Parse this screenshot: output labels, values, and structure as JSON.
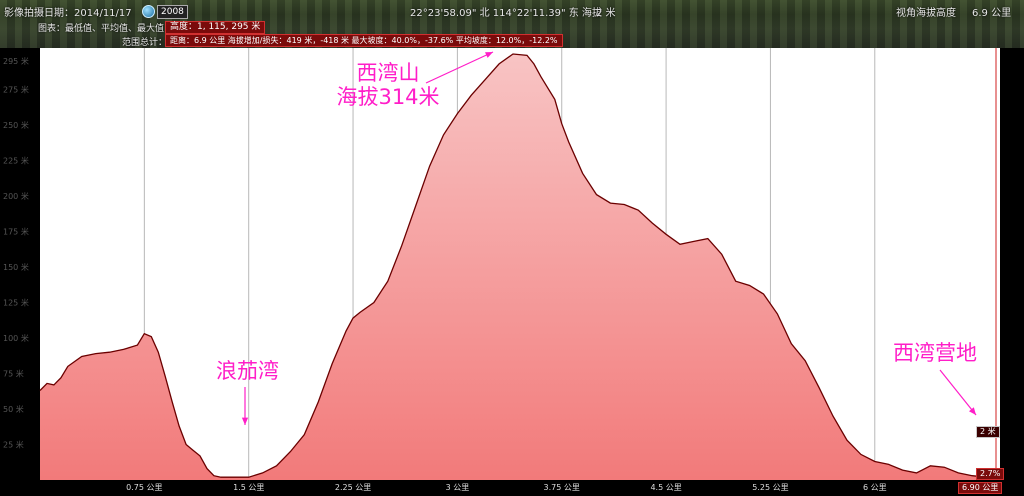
{
  "header": {
    "imagery_date": "影像拍摄日期：2014/11/17",
    "year_badge": "2008",
    "coords": "22°23'58.09\" 北 114°22'11.39\" 东 海拔",
    "altitude": "2 米",
    "eye_alt": "视角海拔高度",
    "eye_alt_value": "6.9 公里",
    "row2_label": "图表：最低值、平均值、最大值",
    "height_readout": "高度：1, 115, 295 米",
    "row3_label": "范围总计：",
    "summary": "距离：6.9 公里 海拔增加/损失：419 米，-418 米 最大坡度：40.0%，-37.6% 平均坡度：12.0%，-12.2%"
  },
  "end_badges": {
    "elev": "2 米",
    "slope": "2.7%",
    "distance": "6.90 公里"
  },
  "icons": {
    "globe": "globe-icon",
    "arrow": "arrow-pointer"
  },
  "colors": {
    "fill_top": "#f8c4c4",
    "fill_bottom": "#f27a7a",
    "line": "#6b0000",
    "annotation": "#ff1ec8"
  },
  "chart_data": {
    "type": "area",
    "xlabel": "",
    "ylabel": "",
    "xlim": [
      0,
      6.9
    ],
    "ylim": [
      0,
      300
    ],
    "y_ticks": [
      25,
      50,
      75,
      100,
      125,
      150,
      175,
      200,
      225,
      250,
      275,
      295
    ],
    "y_tick_labels": [
      "25 米",
      "50 米",
      "75 米",
      "100 米",
      "125 米",
      "150 米",
      "175 米",
      "200 米",
      "225 米",
      "250 米",
      "275 米",
      "295 米"
    ],
    "x_ticks": [
      0.75,
      1.5,
      2.25,
      3.0,
      3.75,
      4.5,
      5.25,
      6.0
    ],
    "x_tick_labels": [
      "0.75 公里",
      "1.5 公里",
      "2.25 公里",
      "3 公里",
      "3.75 公里",
      "4.5 公里",
      "5.25 公里",
      "6 公里"
    ],
    "x": [
      0.0,
      0.05,
      0.1,
      0.15,
      0.2,
      0.3,
      0.4,
      0.5,
      0.6,
      0.7,
      0.75,
      0.8,
      0.85,
      0.9,
      0.95,
      1.0,
      1.05,
      1.1,
      1.15,
      1.2,
      1.25,
      1.3,
      1.35,
      1.4,
      1.45,
      1.5,
      1.6,
      1.7,
      1.8,
      1.9,
      2.0,
      2.1,
      2.2,
      2.25,
      2.3,
      2.4,
      2.5,
      2.6,
      2.7,
      2.8,
      2.9,
      3.0,
      3.1,
      3.2,
      3.3,
      3.4,
      3.5,
      3.55,
      3.6,
      3.7,
      3.75,
      3.8,
      3.9,
      4.0,
      4.1,
      4.2,
      4.3,
      4.4,
      4.5,
      4.6,
      4.7,
      4.8,
      4.9,
      5.0,
      5.1,
      5.2,
      5.3,
      5.4,
      5.5,
      5.6,
      5.7,
      5.8,
      5.9,
      6.0,
      6.1,
      6.2,
      6.3,
      6.4,
      6.5,
      6.6,
      6.7,
      6.8,
      6.9
    ],
    "series": [
      {
        "values": [
          63,
          68,
          67,
          72,
          80,
          87,
          89,
          90,
          92,
          95,
          103,
          101,
          90,
          73,
          55,
          38,
          25,
          21,
          17,
          8,
          3,
          2,
          2,
          2,
          2,
          2,
          5,
          10,
          20,
          32,
          55,
          82,
          105,
          114,
          118,
          125,
          140,
          165,
          193,
          221,
          243,
          258,
          271,
          282,
          293,
          300,
          299,
          293,
          284,
          268,
          251,
          238,
          216,
          201,
          195,
          194,
          190,
          181,
          173,
          166,
          168,
          170,
          159,
          140,
          137,
          131,
          117,
          96,
          84,
          65,
          45,
          28,
          18,
          13,
          11,
          7,
          5,
          10,
          9,
          5,
          3,
          2,
          2
        ]
      }
    ],
    "annotations": [
      {
        "text_lines": [
          "西湾山",
          "海拔314米"
        ],
        "target_x": 3.45
      },
      {
        "text_lines": [
          "浪茄湾"
        ],
        "target_x": 1.45
      },
      {
        "text_lines": [
          "西湾营地"
        ],
        "target_x": 6.88
      }
    ]
  }
}
